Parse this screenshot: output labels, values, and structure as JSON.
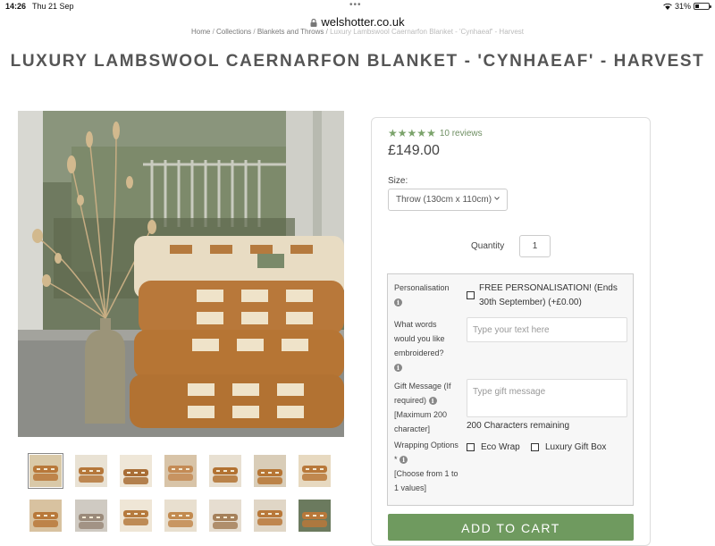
{
  "status": {
    "time": "14:26",
    "date": "Thu 21 Sep",
    "battery": "31%",
    "battery_level": 0.31
  },
  "browser": {
    "url": "welshotter.co.uk"
  },
  "breadcrumb": {
    "items": [
      "Home",
      "Collections",
      "Blankets and Throws"
    ],
    "current": "Luxury Lambswool Caernarfon Blanket - 'Cynhaeaf' - Harvest"
  },
  "product": {
    "title": "LUXURY LAMBSWOOL CAERNARFON BLANKET - 'CYNHAEAF' - HARVEST",
    "rating": 5,
    "reviews": "10 reviews",
    "price": "£149.00",
    "size_label": "Size:",
    "size_value": "Throw (130cm x 110cm)",
    "quantity_label": "Quantity",
    "quantity_value": "1",
    "star_color": "#7ba36b",
    "thumbnails": 14
  },
  "personalisation": {
    "label": "Personalisation",
    "free_option": "FREE PERSONALISATION! (Ends 30th September) (+£0.00)",
    "words_label": "What words would you like embroidered?",
    "words_placeholder": "Type your text here",
    "gift_label": "Gift Message (If required)",
    "gift_max": "[Maximum 200 character]",
    "gift_placeholder": "Type gift message",
    "chars_remaining": "200 Characters remaining",
    "wrapping_label": "Wrapping Options *",
    "wrapping_note": "[Choose from 1 to 1 values]",
    "eco_wrap": "Eco Wrap",
    "luxury_gift_box": "Luxury Gift Box"
  },
  "cart": {
    "label": "ADD TO CART",
    "color": "#6f9a5f"
  }
}
